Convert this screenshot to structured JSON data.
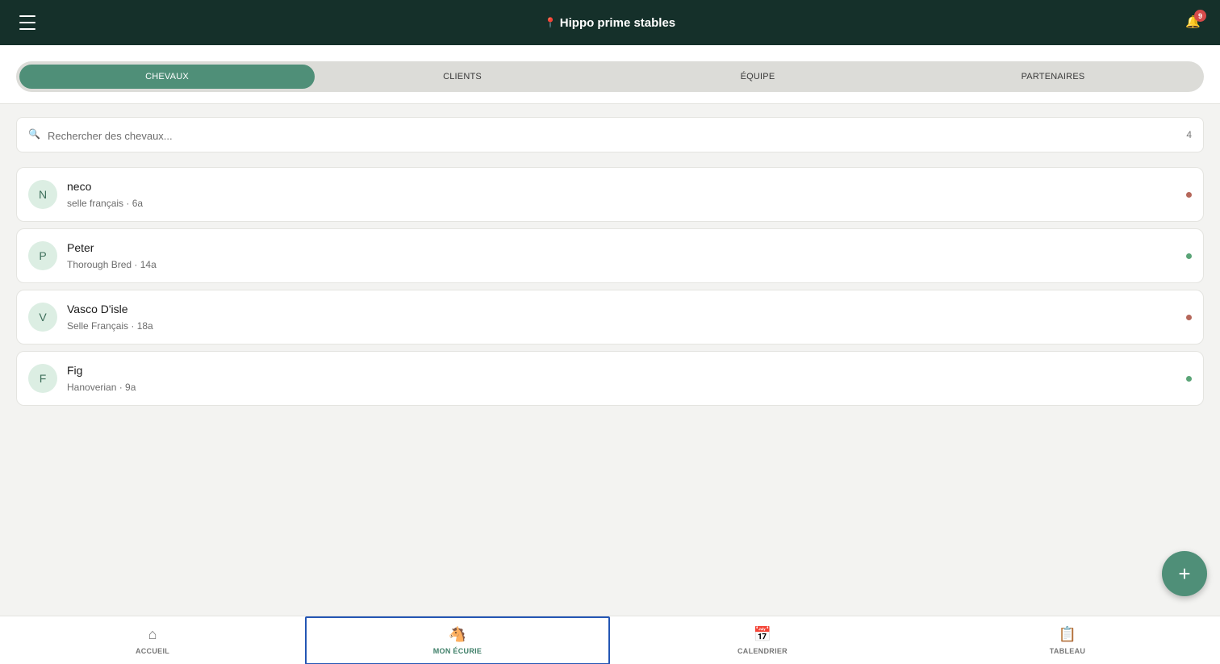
{
  "header": {
    "title": "Hippo prime stables",
    "notification_count": "9"
  },
  "tabs": [
    {
      "label": "CHEVAUX",
      "active": true
    },
    {
      "label": "CLIENTS",
      "active": false
    },
    {
      "label": "ÉQUIPE",
      "active": false
    },
    {
      "label": "PARTENAIRES",
      "active": false
    }
  ],
  "search": {
    "placeholder": "Rechercher des chevaux...",
    "value": "",
    "count": "4"
  },
  "horses": [
    {
      "initial": "N",
      "name": "neco",
      "details": "selle français · 6a",
      "status_color": "#b5675a"
    },
    {
      "initial": "P",
      "name": "Peter",
      "details": "Thorough Bred · 14a",
      "status_color": "#5aa477"
    },
    {
      "initial": "V",
      "name": "Vasco D'isle",
      "details": "Selle Français · 18a",
      "status_color": "#b5675a"
    },
    {
      "initial": "F",
      "name": "Fig",
      "details": "Hanoverian · 9a",
      "status_color": "#5aa477"
    }
  ],
  "fab": {
    "icon": "+"
  },
  "bottom_nav": [
    {
      "label": "ACCUEIL",
      "icon": "⌂",
      "icon_name": "home-icon",
      "active": false
    },
    {
      "label": "MON ÉCURIE",
      "icon": "🐴",
      "icon_name": "horse-icon",
      "active": true
    },
    {
      "label": "CALENDRIER",
      "icon": "📅",
      "icon_name": "calendar-icon",
      "active": false
    },
    {
      "label": "TABLEAU",
      "icon": "📋",
      "icon_name": "clipboard-icon",
      "active": false
    }
  ],
  "colors": {
    "header_bg": "#15302a",
    "accent": "#4f8f78",
    "active_outline": "#2456b4",
    "badge": "#d64a4a"
  }
}
